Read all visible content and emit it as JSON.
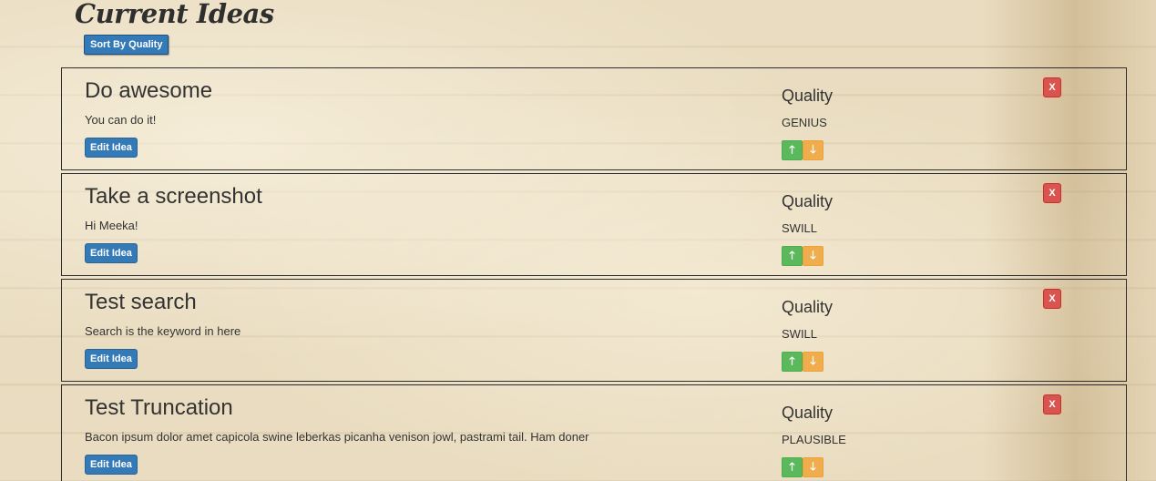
{
  "page": {
    "title": "Current Ideas",
    "sort_button_label": "Sort By Quality"
  },
  "ideas": [
    {
      "title": "Do awesome",
      "body": "You can do it!",
      "edit_label": "Edit Idea",
      "quality_heading": "Quality",
      "quality_value": "GENIUS",
      "delete_label": "X"
    },
    {
      "title": "Take a screenshot",
      "body": "Hi Meeka!",
      "edit_label": "Edit Idea",
      "quality_heading": "Quality",
      "quality_value": "SWILL",
      "delete_label": "X"
    },
    {
      "title": "Test search",
      "body": "Search is the keyword in here",
      "edit_label": "Edit Idea",
      "quality_heading": "Quality",
      "quality_value": "SWILL",
      "delete_label": "X"
    },
    {
      "title": "Test Truncation",
      "body": "Bacon ipsum dolor amet capicola swine leberkas picanha venison jowl, pastrami tail. Ham doner",
      "edit_label": "Edit Idea",
      "quality_heading": "Quality",
      "quality_value": "PLAUSIBLE",
      "delete_label": "X"
    }
  ],
  "icons": {
    "upvote": "arrow-up-icon",
    "downvote": "arrow-down-icon"
  },
  "colors": {
    "primary": "#337ab7",
    "upvote": "#5cb85c",
    "downvote": "#f0ad4e",
    "delete": "#d9534f"
  }
}
